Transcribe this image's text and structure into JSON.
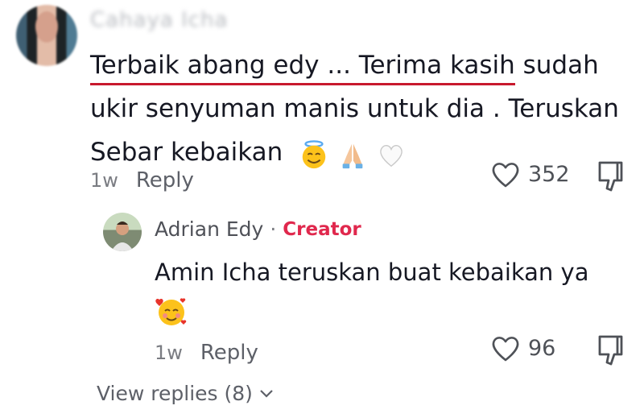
{
  "comment": {
    "username": "Cahaya Icha",
    "text_underlined": "Terbaik abang edy ... Terima kasih",
    "text_rest": " sudah ukir senyuman manis untuk dia . Teruskan Sebar kebaikan",
    "emojis": [
      "halo-smile-icon",
      "praying-hands-icon",
      "white-heart-icon"
    ],
    "time": "1w",
    "reply_label": "Reply",
    "like_count": "352"
  },
  "reply": {
    "name": "Adrian Edy",
    "separator": "·",
    "badge": "Creator",
    "text": "Amin Icha teruskan buat kebaikan ya",
    "emoji": "smiling-face-with-hearts-icon",
    "time": "1w",
    "reply_label": "Reply",
    "like_count": "96"
  },
  "view_replies_label": "View replies (8)",
  "colors": {
    "creator": "#e0284d",
    "underline": "#c8192d",
    "muted": "#7a7c82"
  }
}
